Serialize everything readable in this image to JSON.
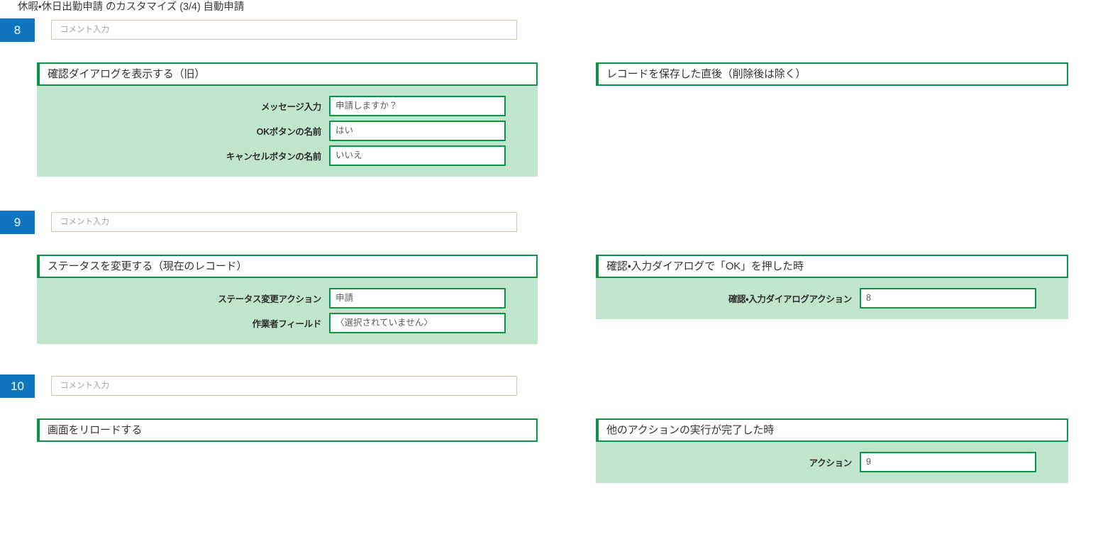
{
  "page": {
    "title": "休暇・休日出勤申請 のカスタマイズ (3/4) 自動申請",
    "accent_blue": "#0d76bf",
    "accent_green": "#0c9444",
    "panel_body_green": "#c1e5cc",
    "comment_border": "#d6c3ae"
  },
  "comment_placeholder": "コメント入力",
  "steps": [
    {
      "number": "8",
      "comment_value": "",
      "action": {
        "header": "確認ダイアログを表示する（旧）",
        "fields": [
          {
            "label": "メッセージ入力",
            "value": "申請しますか？"
          },
          {
            "label": "OKボタンの名前",
            "value": "はい"
          },
          {
            "label": "キャンセルボタンの名前",
            "value": "いいえ"
          }
        ]
      },
      "trigger": {
        "header": "レコードを保存した直後（削除後は除く）",
        "fields": []
      }
    },
    {
      "number": "9",
      "comment_value": "",
      "action": {
        "header": "ステータスを変更する（現在のレコード）",
        "fields": [
          {
            "label": "ステータス変更アクション",
            "value": "申請"
          },
          {
            "label": "作業者フィールド",
            "value": "〈選択されていません〉"
          }
        ]
      },
      "trigger": {
        "header": "確認・入力ダイアログで「OK」を押した時",
        "fields": [
          {
            "label": "確認・入力ダイアログアクション",
            "value": "8"
          }
        ]
      }
    },
    {
      "number": "10",
      "comment_value": "",
      "action": {
        "header": "画面をリロードする",
        "fields": []
      },
      "trigger": {
        "header": "他のアクションの実行が完了した時",
        "fields": [
          {
            "label": "アクション",
            "value": "9"
          }
        ]
      }
    }
  ]
}
